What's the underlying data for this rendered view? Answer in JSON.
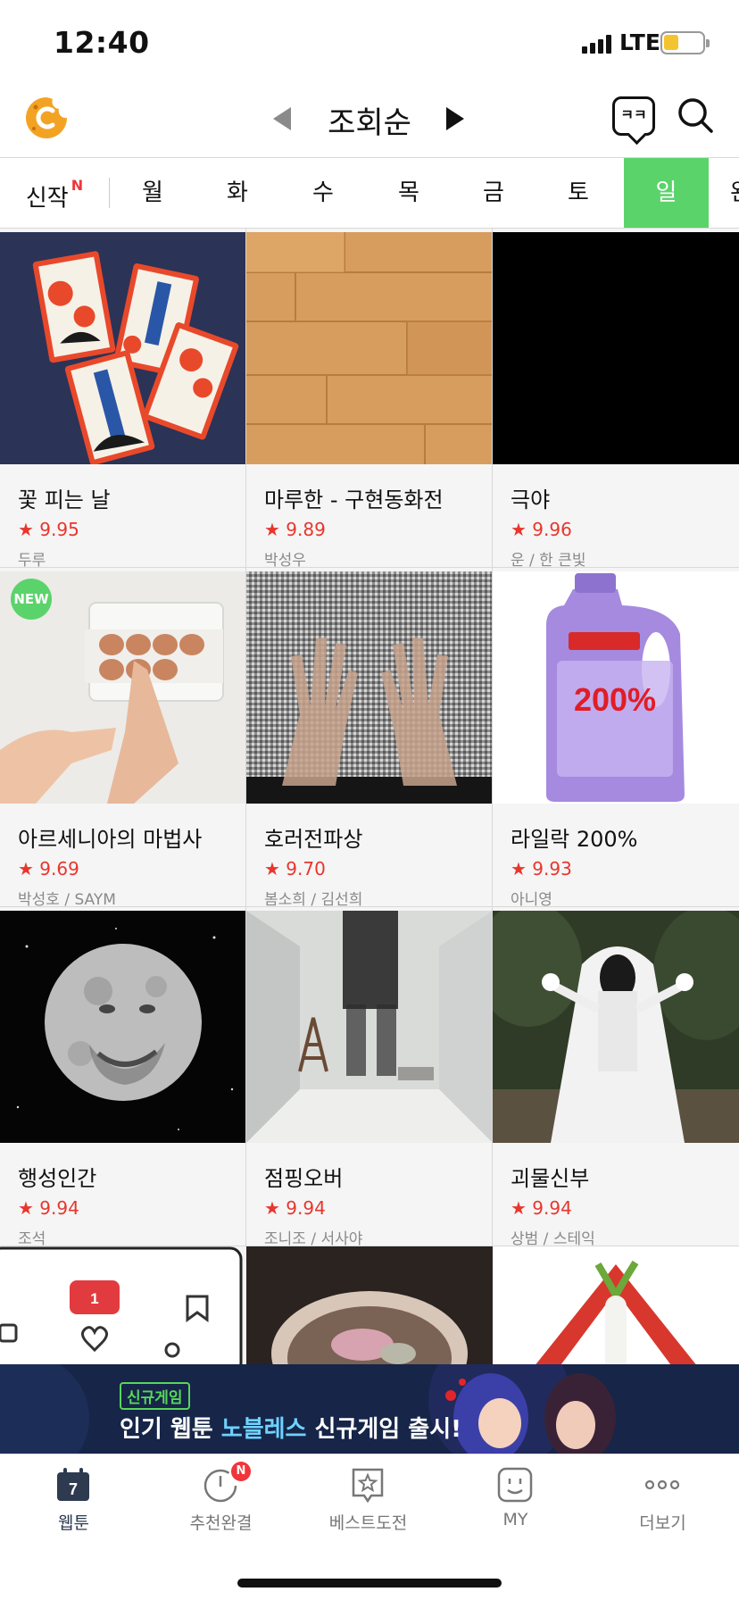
{
  "status_bar": {
    "time": "12:40",
    "network": "LTE",
    "battery_level": 0.4
  },
  "header": {
    "logo_icon": "cookie-logo-icon",
    "sort_label": "조회순",
    "chat_icon_text": "ㅋㅋ",
    "search_icon": "search-icon"
  },
  "tabs": [
    {
      "label": "신작",
      "badge": "N"
    },
    {
      "label": "월"
    },
    {
      "label": "화"
    },
    {
      "label": "수"
    },
    {
      "label": "목"
    },
    {
      "label": "금"
    },
    {
      "label": "토"
    },
    {
      "label": "일",
      "active": true
    },
    {
      "label": "완"
    }
  ],
  "webtoons": [
    {
      "title": "꽃 피는 날",
      "rating": "9.95",
      "author": "두루"
    },
    {
      "title": "마루한 - 구현동화전",
      "rating": "9.89",
      "author": "박성우"
    },
    {
      "title": "극야",
      "rating": "9.96",
      "author": "운 / 한 큰빛"
    },
    {
      "title": "아르세니아의 마법사",
      "rating": "9.69",
      "author": "박성호 / SAYM",
      "badge": "NEW"
    },
    {
      "title": "호러전파상",
      "rating": "9.70",
      "author": "봄소희 / 김선희"
    },
    {
      "title": "라일락 200%",
      "rating": "9.93",
      "author": "아니영"
    },
    {
      "title": "행성인간",
      "rating": "9.94",
      "author": "조석"
    },
    {
      "title": "점핑오버",
      "rating": "9.94",
      "author": "조니조 / 서사야"
    },
    {
      "title": "괴물신부",
      "rating": "9.94",
      "author": "상범 / 스테익"
    }
  ],
  "rating_star": "★",
  "thumb_texts": {
    "lilac_percent": "200%",
    "heart_count": "1"
  },
  "ad": {
    "tag": "신규게임",
    "text_prefix": "인기 웹툰 ",
    "text_highlight": "노블레스",
    "text_suffix": " 신규게임 출시!"
  },
  "bottom_nav": [
    {
      "label": "웹툰",
      "icon": "calendar-7-icon",
      "icon_text": "7",
      "active": true
    },
    {
      "label": "추천완결",
      "icon": "clock-icon",
      "badge": "N"
    },
    {
      "label": "베스트도전",
      "icon": "star-bookmark-icon"
    },
    {
      "label": "MY",
      "icon": "smile-icon"
    },
    {
      "label": "더보기",
      "icon": "more-dots-icon"
    }
  ]
}
